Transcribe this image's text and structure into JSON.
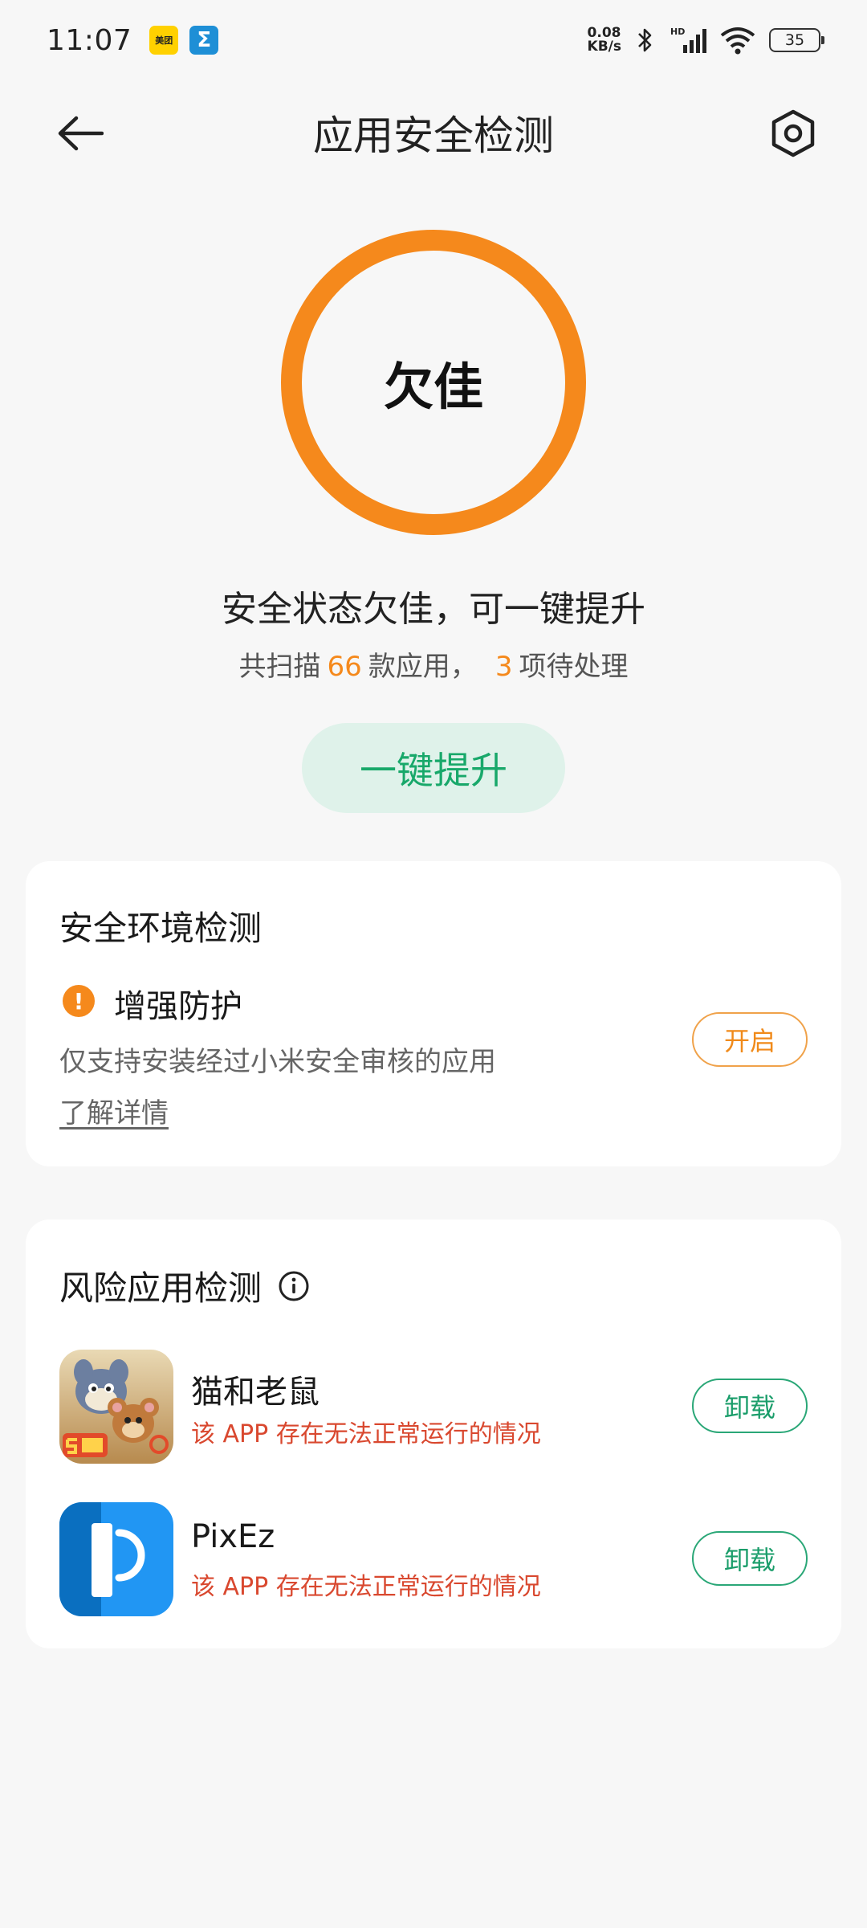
{
  "status_bar": {
    "time": "11:07",
    "notif_meituan_label": "美团",
    "notif_sigma_label": "Σ",
    "net_speed_value": "0.08",
    "net_speed_unit": "KB/s",
    "hd_label": "HD",
    "battery_level": "35"
  },
  "header": {
    "title": "应用安全检测"
  },
  "score": {
    "label": "欠佳",
    "ring_color": "#f5891c"
  },
  "summary": {
    "title": "安全状态欠佳，可一键提升",
    "prefix": "共扫描",
    "scanned_count": "66",
    "middle": "款应用，",
    "pending_count": "3",
    "suffix": "项待处理"
  },
  "boost_button": {
    "label": "一键提升"
  },
  "env_card": {
    "title": "安全环境检测",
    "item_title": "增强防护",
    "item_desc": "仅支持安装经过小米安全审核的应用",
    "link": "了解详情",
    "button": "开启"
  },
  "risk_card": {
    "title": "风险应用检测",
    "apps": [
      {
        "name": "猫和老鼠",
        "warning": "该 APP 存在无法正常运行的情况",
        "button": "卸载"
      },
      {
        "name": "PixEz",
        "warning": "该 APP 存在无法正常运行的情况",
        "button": "卸载"
      }
    ]
  },
  "icons": {
    "back": "arrow-left-icon",
    "settings": "hexagon-gear-icon",
    "warning": "exclamation-circle-icon",
    "info": "info-circle-icon"
  },
  "colors": {
    "accent_orange": "#f5891c",
    "accent_green": "#1a9d6a",
    "warning_red": "#d9482f"
  }
}
